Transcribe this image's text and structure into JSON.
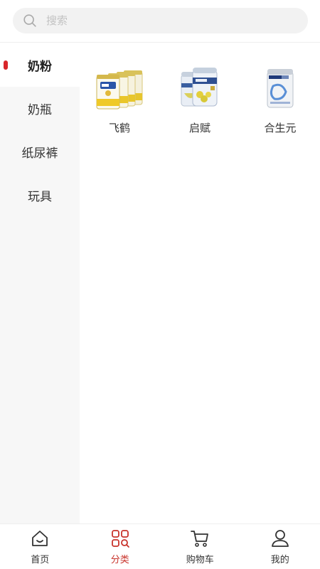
{
  "search": {
    "placeholder": "搜索",
    "value": ""
  },
  "sidebar": {
    "items": [
      {
        "label": "奶粉",
        "active": true
      },
      {
        "label": "奶瓶",
        "active": false
      },
      {
        "label": "纸尿裤",
        "active": false
      },
      {
        "label": "玩具",
        "active": false
      }
    ]
  },
  "products": [
    {
      "name": "飞鹤",
      "icon": "feihe-milk-powder-image"
    },
    {
      "name": "启赋",
      "icon": "illuma-milk-powder-image"
    },
    {
      "name": "合生元",
      "icon": "biostime-milk-powder-image"
    }
  ],
  "tabbar": {
    "items": [
      {
        "label": "首页",
        "icon": "home-icon",
        "active": false
      },
      {
        "label": "分类",
        "icon": "category-icon",
        "active": true
      },
      {
        "label": "购物车",
        "icon": "cart-icon",
        "active": false
      },
      {
        "label": "我的",
        "icon": "user-icon",
        "active": false
      }
    ]
  },
  "colors": {
    "accent": "#c8332b",
    "indicator": "#d8262a",
    "sidebar_bg": "#f7f7f7",
    "search_bg": "#f2f2f2"
  }
}
